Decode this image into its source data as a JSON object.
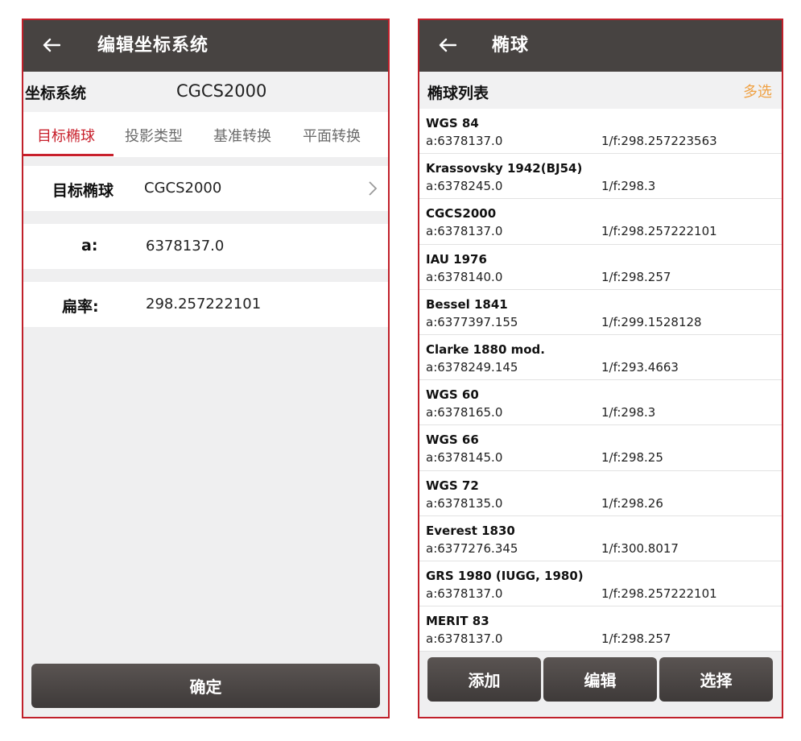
{
  "left": {
    "title": "编辑坐标系统",
    "coord_label": "坐标系统",
    "coord_value": "CGCS2000",
    "tabs": [
      "目标椭球",
      "投影类型",
      "基准转换",
      "平面转换"
    ],
    "ellipsoid_label": "目标椭球",
    "ellipsoid_value": "CGCS2000",
    "a_label": "a:",
    "a_value": "6378137.0",
    "flattening_label": "扁率:",
    "flattening_value": "298.257222101",
    "confirm": "确定"
  },
  "right": {
    "title": "椭球",
    "list_title": "椭球列表",
    "multi_select": "多选",
    "items": [
      {
        "name": "WGS 84",
        "a": "a:6378137.0",
        "f": "1/f:298.257223563"
      },
      {
        "name": "Krassovsky 1942(BJ54)",
        "a": "a:6378245.0",
        "f": "1/f:298.3"
      },
      {
        "name": "CGCS2000",
        "a": "a:6378137.0",
        "f": "1/f:298.257222101"
      },
      {
        "name": "IAU 1976",
        "a": "a:6378140.0",
        "f": "1/f:298.257"
      },
      {
        "name": "Bessel 1841",
        "a": "a:6377397.155",
        "f": "1/f:299.1528128"
      },
      {
        "name": "Clarke 1880 mod.",
        "a": "a:6378249.145",
        "f": "1/f:293.4663"
      },
      {
        "name": "WGS 60",
        "a": "a:6378165.0",
        "f": "1/f:298.3"
      },
      {
        "name": "WGS 66",
        "a": "a:6378145.0",
        "f": "1/f:298.25"
      },
      {
        "name": "WGS 72",
        "a": "a:6378135.0",
        "f": "1/f:298.26"
      },
      {
        "name": "Everest 1830",
        "a": "a:6377276.345",
        "f": "1/f:300.8017"
      },
      {
        "name": "GRS 1980 (IUGG, 1980)",
        "a": "a:6378137.0",
        "f": "1/f:298.257222101"
      },
      {
        "name": "MERIT 83",
        "a": "a:6378137.0",
        "f": "1/f:298.257"
      }
    ],
    "buttons": {
      "add": "添加",
      "edit": "编辑",
      "select": "选择"
    }
  },
  "icons": {
    "back": "arrow-left-icon",
    "chevron": "chevron-right-icon"
  },
  "colors": {
    "appbar": "#474341",
    "accent": "#c8202c",
    "multi_select": "#f0a143",
    "frame": "#c0202a"
  }
}
